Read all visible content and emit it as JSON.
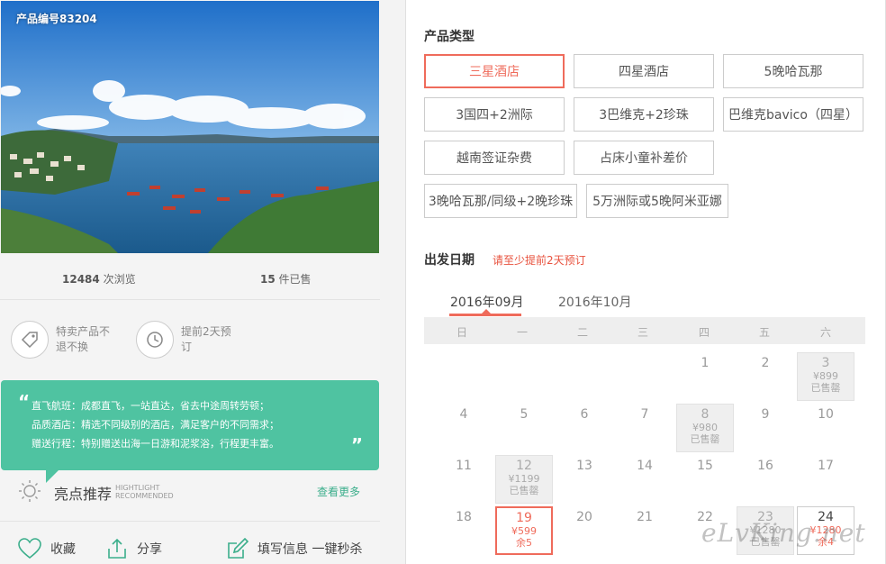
{
  "product": {
    "code": "产品编号83204",
    "views_num": "12484",
    "views_label": "次浏览",
    "sold_num": "15",
    "sold_label": "件已售"
  },
  "tags": [
    {
      "icon": "price-tag-icon",
      "text": "特卖产品不退不换"
    },
    {
      "icon": "clock-icon",
      "text": "提前2天预订"
    }
  ],
  "highlights": {
    "lines": [
      "直飞航班：成都直飞，一站直达，省去中途周转劳顿；",
      "品质酒店：精选不同级别的酒店，满足客户的不同需求；",
      "赠送行程：特别赠送出海一日游和泥浆浴，行程更丰富。"
    ],
    "title": "亮点推荐",
    "sub1": "HIGHTLIGHT",
    "sub2": "RECOMMENDED",
    "more": "查看更多"
  },
  "actions": {
    "favorite": "收藏",
    "share": "分享",
    "fill_info": "填写信息 一键秒杀"
  },
  "product_type": {
    "title": "产品类型",
    "options": [
      "三星酒店",
      "四星酒店",
      "5晚哈瓦那",
      "3国四+2洲际",
      "3巴维克+2珍珠",
      "巴维克bavico（四星）",
      "越南签证杂费",
      "占床小童补差价",
      "3晚哈瓦那/同级+2晚珍珠",
      "5万洲际或5晚阿米亚娜"
    ],
    "selected": "三星酒店"
  },
  "departure": {
    "title": "出发日期",
    "note": "请至少提前2天预订",
    "months": [
      "2016年09月",
      "2016年10月"
    ],
    "active_month": "2016年09月",
    "weekdays": [
      "日",
      "一",
      "二",
      "三",
      "四",
      "五",
      "六"
    ],
    "days": [
      {
        "day": "1"
      },
      {
        "day": "2"
      },
      {
        "day": "3",
        "price": "¥899",
        "status": "已售罄"
      },
      {
        "day": "4"
      },
      {
        "day": "5"
      },
      {
        "day": "6"
      },
      {
        "day": "7"
      },
      {
        "day": "8",
        "price": "¥980",
        "status": "已售罄"
      },
      {
        "day": "9"
      },
      {
        "day": "10"
      },
      {
        "day": "11"
      },
      {
        "day": "12",
        "price": "¥1199",
        "status": "已售罄"
      },
      {
        "day": "13"
      },
      {
        "day": "14"
      },
      {
        "day": "15"
      },
      {
        "day": "16"
      },
      {
        "day": "17"
      },
      {
        "day": "18"
      },
      {
        "day": "19",
        "price": "¥599",
        "status": "余5"
      },
      {
        "day": "20"
      },
      {
        "day": "21"
      },
      {
        "day": "22"
      },
      {
        "day": "23",
        "price": "¥1280",
        "status": "已售罄"
      },
      {
        "day": "24",
        "price": "¥1280",
        "status": "余4"
      }
    ]
  },
  "watermark": "eLvKing.net",
  "colors": {
    "accent": "#ef6b5b",
    "green": "#4fc3a1"
  }
}
